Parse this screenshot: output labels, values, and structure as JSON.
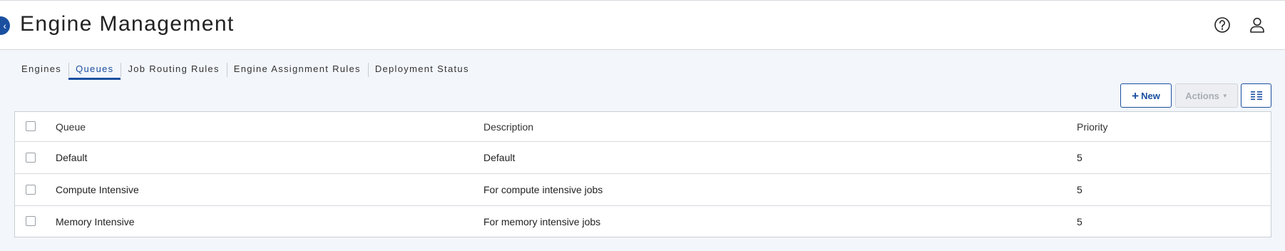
{
  "header": {
    "title": "Engine Management",
    "badge": "‹",
    "help_icon": "help-circle-icon",
    "user_icon": "user-profile-icon"
  },
  "tabs": [
    {
      "label": "Engines",
      "active": false
    },
    {
      "label": "Queues",
      "active": true
    },
    {
      "label": "Job Routing Rules",
      "active": false
    },
    {
      "label": "Engine Assignment Rules",
      "active": false
    },
    {
      "label": "Deployment Status",
      "active": false
    }
  ],
  "toolbar": {
    "new_plus": "+",
    "new_label": "New",
    "actions_label": "Actions",
    "actions_caret": "▼",
    "columns_icon": "column-list-icon"
  },
  "table": {
    "columns": [
      "Queue",
      "Description",
      "Priority"
    ],
    "rows": [
      {
        "queue": "Default",
        "description": "Default",
        "priority": "5"
      },
      {
        "queue": "Compute Intensive",
        "description": "For compute intensive jobs",
        "priority": "5"
      },
      {
        "queue": "Memory Intensive",
        "description": "For memory intensive jobs",
        "priority": "5"
      }
    ]
  },
  "colors": {
    "accent": "#1a4fa0",
    "page_bg": "#f3f6fb",
    "border": "#c9ced5"
  }
}
